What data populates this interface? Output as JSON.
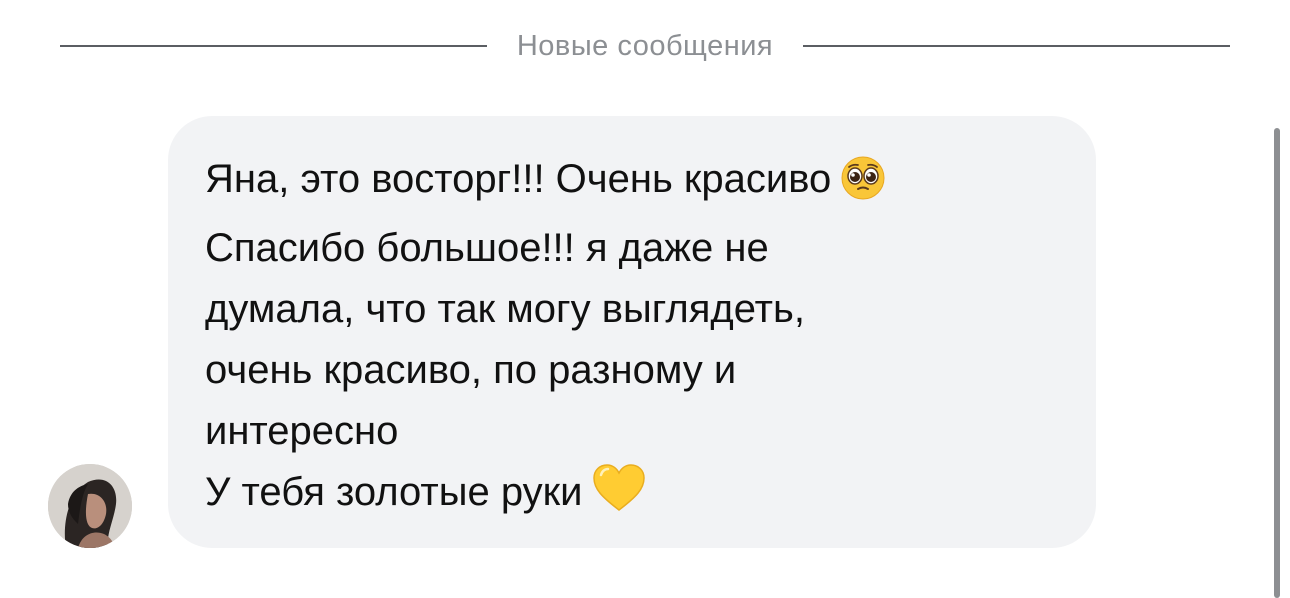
{
  "divider": {
    "label": "Новые сообщения"
  },
  "message": {
    "lines": [
      "Яна, это восторг!!! Очень красиво",
      "Спасибо большое!!! я даже не",
      "думала, что так могу выглядеть,",
      "очень красиво, по разному и",
      "интересно",
      "У тебя золотые руки"
    ],
    "emojis": [
      "pleading-face-emoji",
      "yellow-heart-emoji"
    ]
  },
  "colors": {
    "bubble": "#f2f3f5",
    "text": "#111111",
    "divider_text": "#8c8f93",
    "divider_line": "#5b5e63",
    "scrollbar": "#8d8f92",
    "heart": "#ffcc32"
  }
}
